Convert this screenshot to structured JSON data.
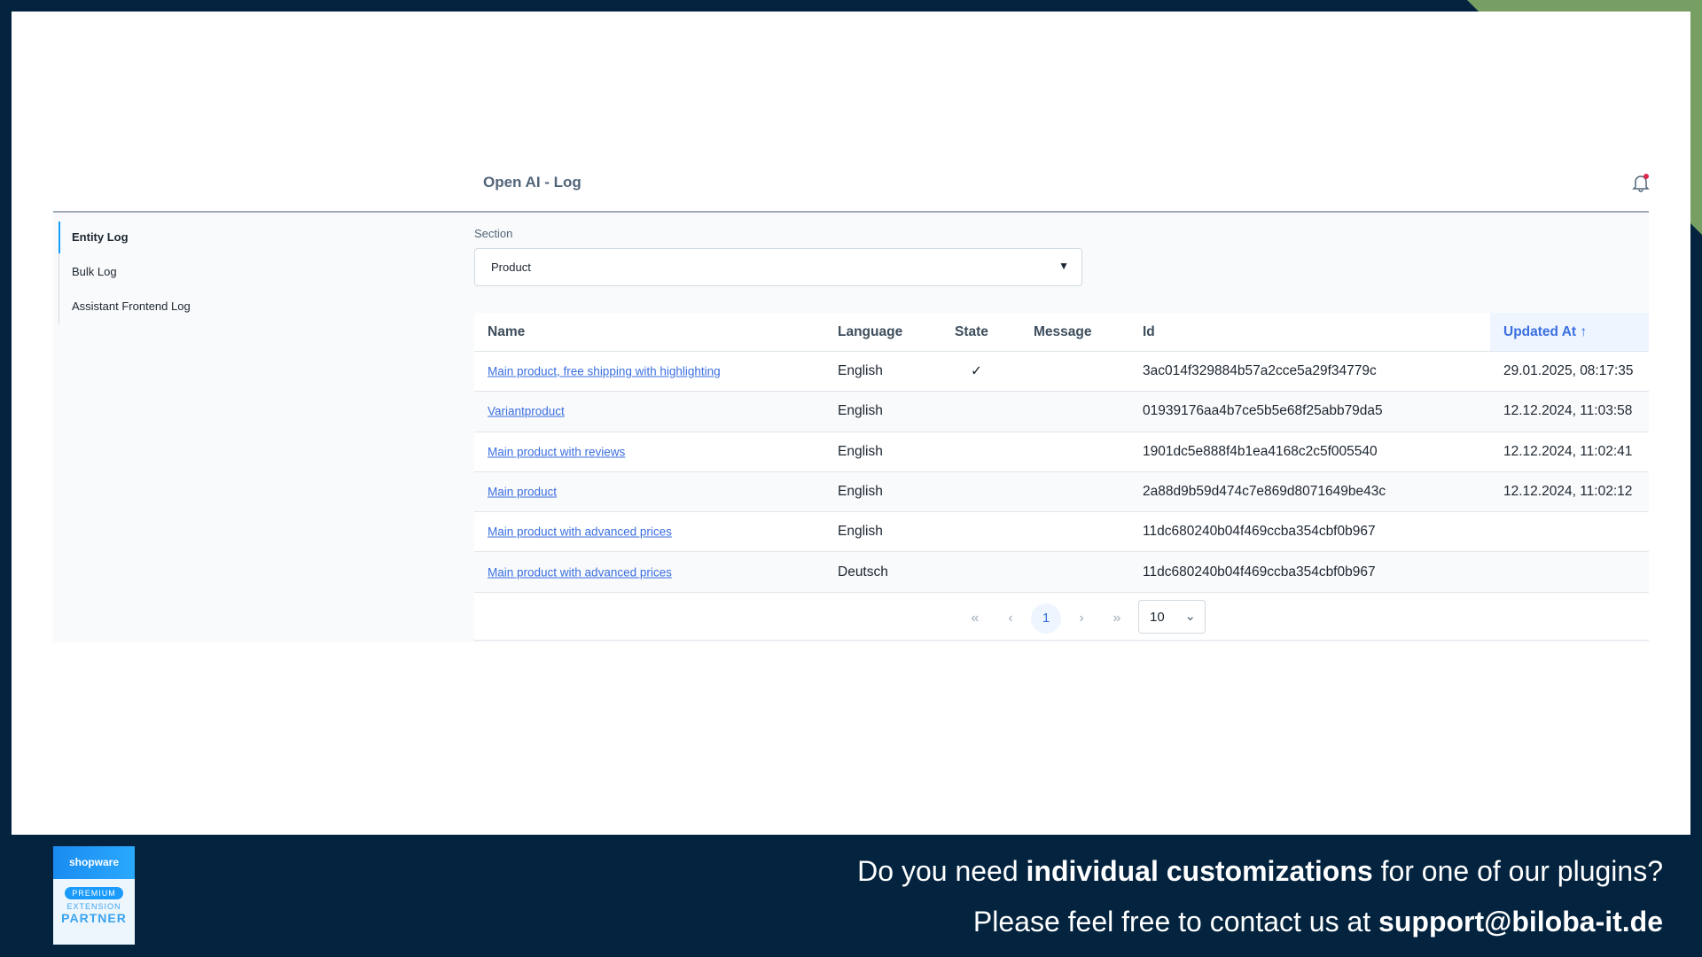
{
  "header": {
    "title": "Open AI - Log",
    "notification_icon": "bell-icon"
  },
  "sidebar": {
    "items": [
      {
        "label": "Entity Log",
        "active": true
      },
      {
        "label": "Bulk Log"
      },
      {
        "label": "Assistant Frontend Log"
      }
    ]
  },
  "section": {
    "label": "Section",
    "value": "Product"
  },
  "table": {
    "columns": [
      "Name",
      "Language",
      "State",
      "Message",
      "Id",
      "Updated At"
    ],
    "sorted_column": "Updated At",
    "rows": [
      {
        "name": "Main product, free shipping with highlighting",
        "language": "English",
        "state": "✓",
        "message": "",
        "id": "3ac014f329884b57a2cce5a29f34779c",
        "updated": "29.01.2025, 08:17:35"
      },
      {
        "name": "Variantproduct",
        "language": "English",
        "state": "",
        "message": "",
        "id": "01939176aa4b7ce5b5e68f25abb79da5",
        "updated": "12.12.2024, 11:03:58"
      },
      {
        "name": "Main product with reviews",
        "language": "English",
        "state": "",
        "message": "",
        "id": "1901dc5e888f4b1ea4168c2c5f005540",
        "updated": "12.12.2024, 11:02:41"
      },
      {
        "name": "Main product",
        "language": "English",
        "state": "",
        "message": "",
        "id": "2a88d9b59d474c7e869d8071649be43c",
        "updated": "12.12.2024, 11:02:12"
      },
      {
        "name": "Main product with advanced prices",
        "language": "English",
        "state": "",
        "message": "",
        "id": "11dc680240b04f469ccba354cbf0b967",
        "updated": ""
      },
      {
        "name": "Main product with advanced prices",
        "language": "Deutsch",
        "state": "",
        "message": "",
        "id": "11dc680240b04f469ccba354cbf0b967",
        "updated": ""
      }
    ]
  },
  "pagination": {
    "first": "«",
    "prev": "‹",
    "current": "1",
    "next": "›",
    "last": "»",
    "per_page": "10"
  },
  "footer": {
    "line1_pre": "Do you need ",
    "line1_bold": "individual customizations",
    "line1_post": " for one of our plugins?",
    "line2_pre": "Please feel free to contact us at ",
    "line2_bold": "support@biloba-it.de"
  },
  "badge": {
    "brand": "shopware",
    "tier": "PREMIUM",
    "line1": "EXTENSION",
    "line2": "PARTNER"
  },
  "colors": {
    "navy": "#03233f",
    "green": "#789f63",
    "accent": "#3b6fe0"
  }
}
